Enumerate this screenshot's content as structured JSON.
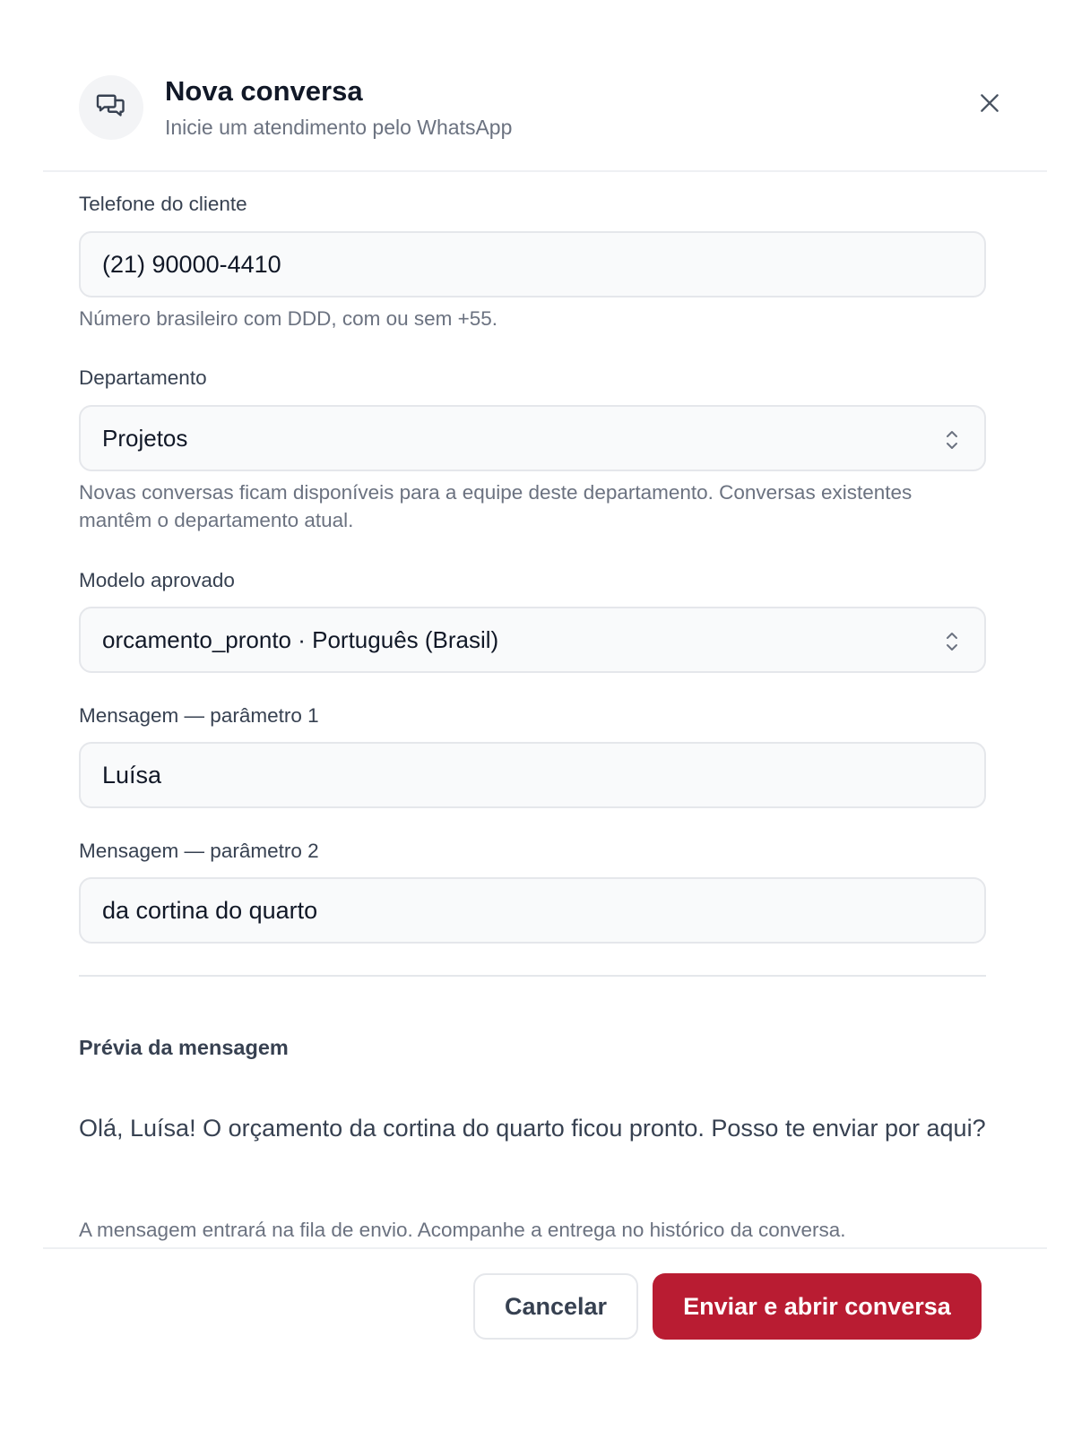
{
  "header": {
    "title": "Nova conversa",
    "subtitle": "Inicie um atendimento pelo WhatsApp",
    "icon": "chat-bubbles-icon",
    "close_icon": "close-icon"
  },
  "form": {
    "phone": {
      "label": "Telefone do cliente",
      "value": "(21) 90000-4410",
      "help": "Número brasileiro com DDD, com ou sem +55."
    },
    "department": {
      "label": "Departamento",
      "selected": "Projetos",
      "help": "Novas conversas ficam disponíveis para a equipe deste departamento. Conversas existentes mantêm o departamento atual."
    },
    "template": {
      "label": "Modelo aprovado",
      "selected": "orcamento_pronto · Português (Brasil)"
    },
    "param1": {
      "label": "Mensagem — parâmetro 1",
      "value": "Luísa"
    },
    "param2": {
      "label": "Mensagem — parâmetro 2",
      "value": "da cortina do quarto"
    }
  },
  "preview": {
    "title": "Prévia da mensagem",
    "text": "Olá, Luísa! O orçamento da cortina do quarto ficou pronto. Posso te enviar por aqui?"
  },
  "footer": {
    "note": "A mensagem entrará na fila de envio. Acompanhe a entrega no histórico da conversa.",
    "cancel_label": "Cancelar",
    "submit_label": "Enviar e abrir conversa"
  },
  "colors": {
    "primary": "#b91c32",
    "muted_text": "#6b7280",
    "field_bg": "#f9fafb",
    "border": "#e5e7eb"
  }
}
